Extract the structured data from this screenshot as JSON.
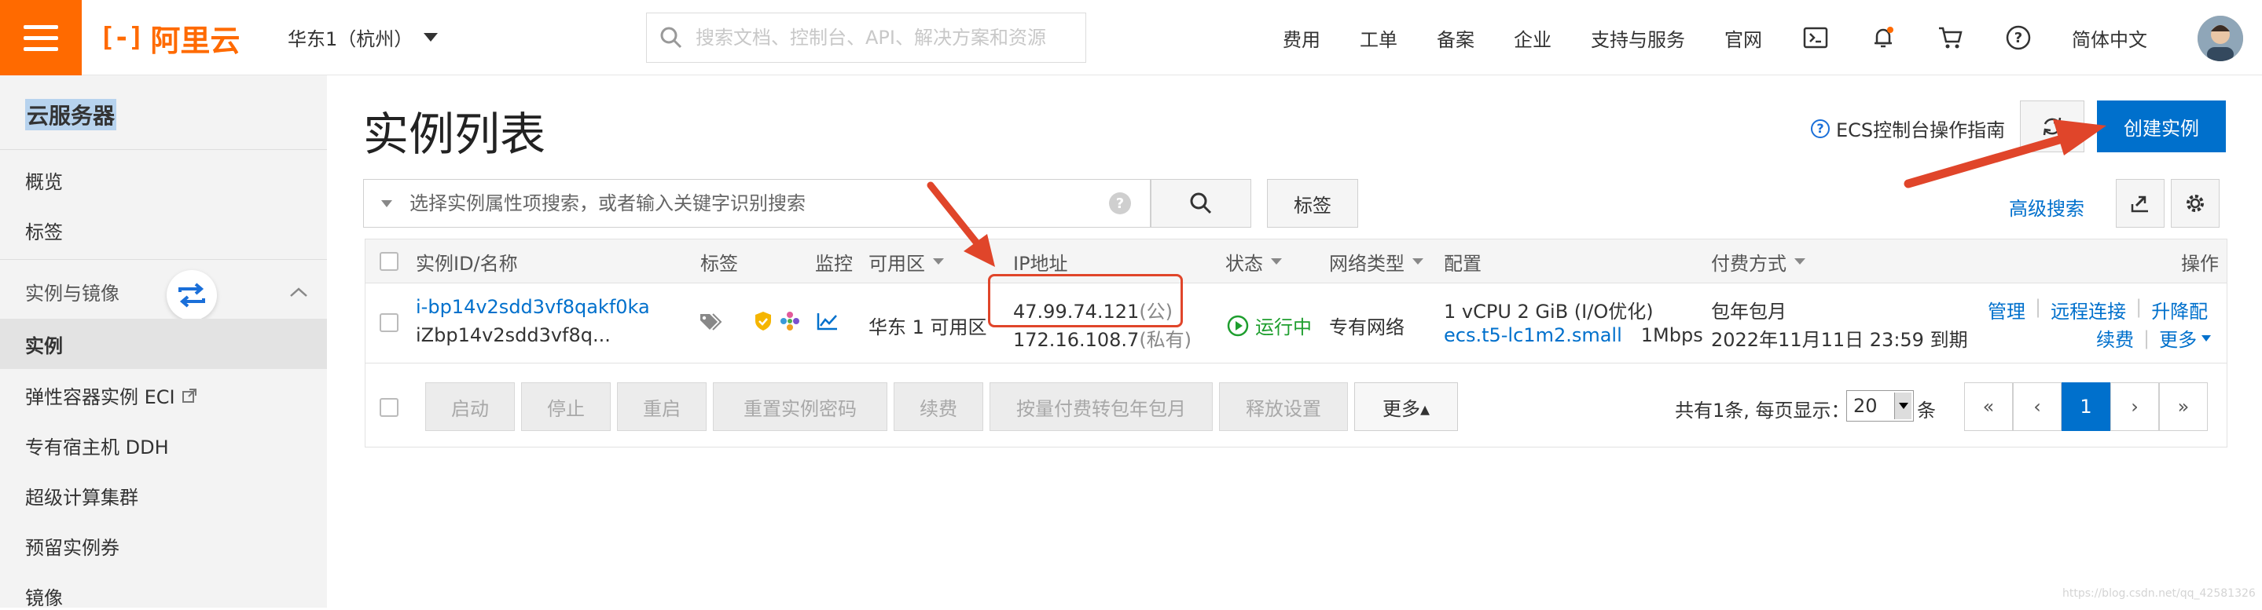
{
  "header": {
    "logo_mark": "[-]",
    "logo_text": "阿里云",
    "region": "华东1（杭州）",
    "search_placeholder": "搜索文档、控制台、API、解决方案和资源",
    "nav": [
      "费用",
      "工单",
      "备案",
      "企业",
      "支持与服务",
      "官网"
    ],
    "language": "简体中文",
    "notification_dot_color": "#ff6a00"
  },
  "sidebar": {
    "title": "云服务器",
    "items_top": [
      "概览",
      "标签"
    ],
    "group_label": "实例与镜像",
    "active_item": "实例",
    "items": [
      "弹性容器实例 ECI",
      "专有宿主机 DDH",
      "超级计算集群",
      "预留实例券",
      "镜像"
    ]
  },
  "main": {
    "title": "实例列表",
    "guide": "ECS控制台操作指南",
    "create_button": "创建实例",
    "filter_placeholder": "选择实例属性项搜索，或者输入关键字识别搜索",
    "tag_button": "标签",
    "advanced_search": "高级搜索"
  },
  "table": {
    "headers": {
      "id_name": "实例ID/名称",
      "tag": "标签",
      "monitor": "监控",
      "zone": "可用区",
      "ip": "IP地址",
      "status": "状态",
      "network": "网络类型",
      "config": "配置",
      "billing": "付费方式",
      "actions": "操作"
    },
    "row": {
      "instance_id": "i-bp14v2sdd3vf8qakf0ka",
      "instance_name": "iZbp14v2sdd3vf8q...",
      "zone": "华东 1 可用区",
      "public_ip": "47.99.74.121",
      "public_suffix": "(公)",
      "private_ip": "172.16.108.7",
      "private_suffix": "(私有)",
      "status": "运行中",
      "network": "专有网络",
      "config_spec": "1 vCPU 2 GiB (I/O优化)",
      "config_type": "ecs.t5-lc1m2.small",
      "bandwidth": "1Mbps",
      "billing_type": "包年包月",
      "expiry": "2022年11月11日 23:59 到期",
      "action_manage": "管理",
      "action_remote": "远程连接",
      "action_upgrade": "升降配",
      "action_renew": "续费",
      "action_more": "更多"
    },
    "status_color": "#1e9e2e"
  },
  "footer": {
    "buttons": [
      "启动",
      "停止",
      "重启",
      "重置实例密码",
      "续费",
      "按量付费转包年包月",
      "释放设置"
    ],
    "more_button": "更多▴",
    "total_text": "共有1条, 每页显示：",
    "page_size": "20",
    "page_unit": "条",
    "pages": [
      "«",
      "‹",
      "1",
      "›",
      "»"
    ]
  },
  "annotation_color": "#e0452a",
  "accent_color": "#0070cc",
  "brand_color": "#ff6a00",
  "watermark": "https://blog.csdn.net/qq_42581326"
}
